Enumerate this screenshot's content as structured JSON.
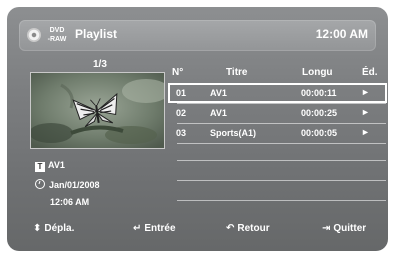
{
  "header": {
    "disc_badge_line1": "DVD",
    "disc_badge_line2": "-RAW",
    "title": "Playlist",
    "clock": "12:00 AM"
  },
  "preview": {
    "counter": "1/3",
    "item_title": "AV1",
    "date": "Jan/01/2008",
    "time": "12:06 AM"
  },
  "table": {
    "headers": {
      "num": "N°",
      "title": "Titre",
      "length": "Longu",
      "edit": "Éd."
    },
    "rows": [
      {
        "num": "01",
        "title": "AV1",
        "length": "00:00:11",
        "edit": "►"
      },
      {
        "num": "02",
        "title": "AV1",
        "length": "00:00:25",
        "edit": "►"
      },
      {
        "num": "03",
        "title": "Sports(A1)",
        "length": "00:00:05",
        "edit": "►"
      }
    ],
    "selected_index": 0
  },
  "footer": {
    "move": {
      "icon": "up-down-arrows-icon",
      "label": "Dépla."
    },
    "enter": {
      "icon": "enter-icon",
      "label": "Entrée"
    },
    "back": {
      "icon": "return-arrow-icon",
      "label": "Retour"
    },
    "quit": {
      "icon": "exit-icon",
      "label": "Quitter"
    }
  }
}
